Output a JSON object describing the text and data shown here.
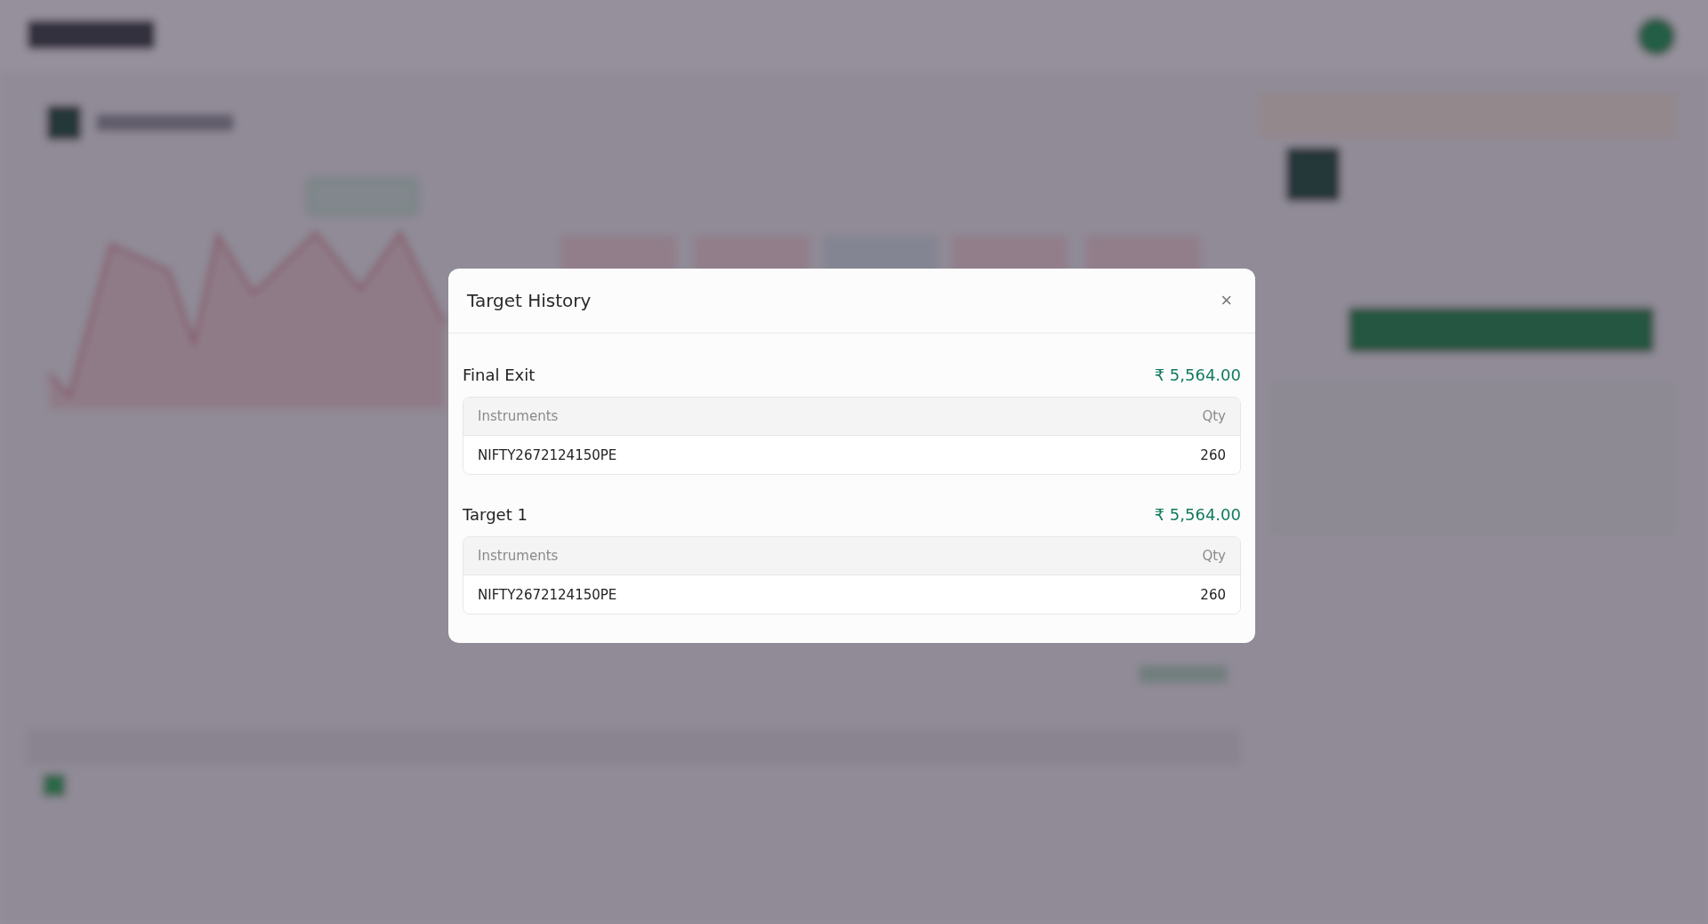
{
  "dialog": {
    "title": "Target History",
    "close_icon": "×",
    "sections": [
      {
        "title": "Final Exit",
        "amount": "₹ 5,564.00",
        "columns": [
          "Instruments",
          "Qty"
        ],
        "rows": [
          {
            "instrument": "NIFTY2672124150PE",
            "qty": "260"
          }
        ]
      },
      {
        "title": "Target 1",
        "amount": "₹ 5,564.00",
        "columns": [
          "Instruments",
          "Qty"
        ],
        "rows": [
          {
            "instrument": "NIFTY2672124150PE",
            "qty": "260"
          }
        ]
      }
    ]
  }
}
